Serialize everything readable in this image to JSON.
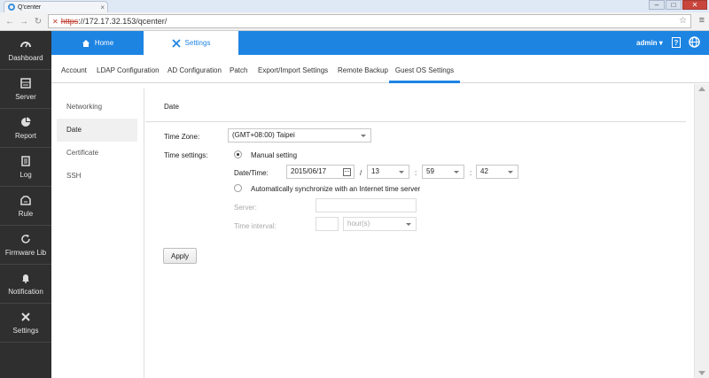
{
  "browser": {
    "tab_title": "Q'center",
    "url_scheme": "https",
    "url_rest": "://172.17.32.153/qcenter/"
  },
  "appnav": {
    "items": [
      {
        "label": "Dashboard",
        "icon": "dashboard-icon"
      },
      {
        "label": "Server",
        "icon": "server-icon"
      },
      {
        "label": "Report",
        "icon": "pie-chart-icon"
      },
      {
        "label": "Log",
        "icon": "log-icon"
      },
      {
        "label": "Rule",
        "icon": "rule-icon"
      },
      {
        "label": "Firmware Lib",
        "icon": "refresh-icon"
      },
      {
        "label": "Notification",
        "icon": "bell-icon"
      },
      {
        "label": "Settings",
        "icon": "tools-icon"
      }
    ]
  },
  "header": {
    "home_label": "Home",
    "settings_label": "Settings",
    "user_label": "admin",
    "accent_color": "#1d84e2"
  },
  "subnav": {
    "tabs": [
      "Account",
      "LDAP Configuration",
      "AD Configuration",
      "Patch",
      "Export/Import Settings",
      "Remote Backup",
      "Guest OS Settings"
    ],
    "active": "Guest OS Settings"
  },
  "sidemenu": {
    "items": [
      "Networking",
      "Date",
      "Certificate",
      "SSH"
    ],
    "active": "Date"
  },
  "date_panel": {
    "title": "Date",
    "timezone_label": "Time Zone:",
    "timezone_value": "(GMT+08:00) Taipei",
    "time_settings_label": "Time settings:",
    "manual_label": "Manual setting",
    "datetime_label": "Date/Time:",
    "date_value": "2015/06/17",
    "slash": "/",
    "hour_value": "13",
    "minute_value": "59",
    "second_value": "42",
    "colon": ":",
    "auto_label": "Automatically synchronize with an Internet time server",
    "server_label": "Server:",
    "interval_label": "Time interval:",
    "interval_unit": "hour(s)",
    "apply_label": "Apply"
  }
}
